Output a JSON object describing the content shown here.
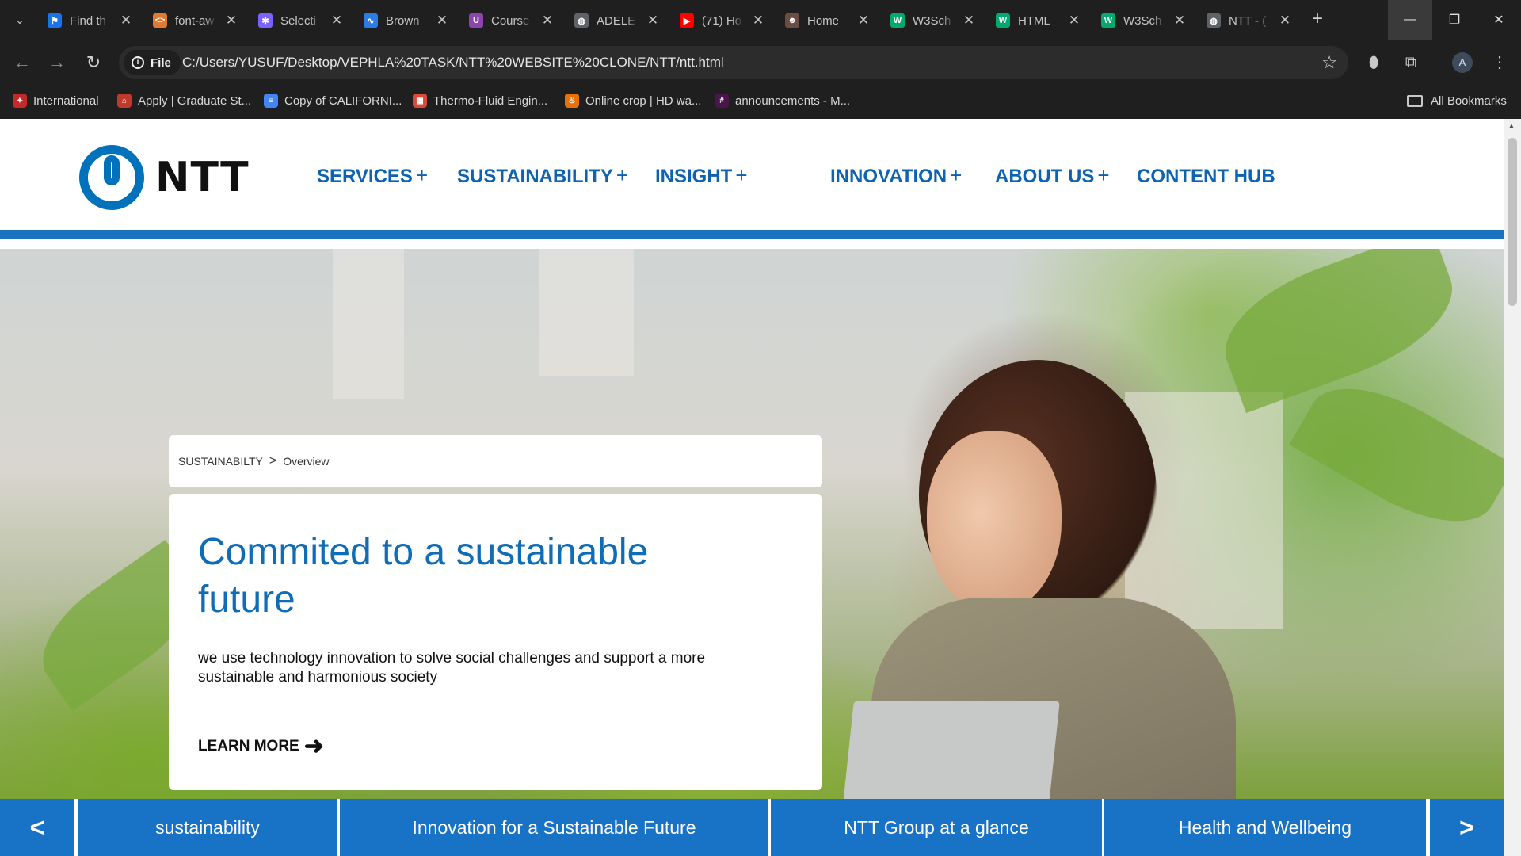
{
  "browser": {
    "tabs": [
      {
        "title": "Find th",
        "favicon": "flag-icon",
        "favicon_color": "#1a73e8",
        "favicon_glyph": "⚑"
      },
      {
        "title": "font-aw",
        "favicon": "code-icon",
        "favicon_color": "#e07a2f",
        "favicon_glyph": "<>"
      },
      {
        "title": "Selecti",
        "favicon": "figma-icon",
        "favicon_color": "#7b61ff",
        "favicon_glyph": "✱"
      },
      {
        "title": "Brown",
        "favicon": "chart-icon",
        "favicon_color": "#2d7be5",
        "favicon_glyph": "∿"
      },
      {
        "title": "Course",
        "favicon": "course-icon",
        "favicon_color": "#8e44ad",
        "favicon_glyph": "U"
      },
      {
        "title": "ADELE",
        "favicon": "globe-icon",
        "favicon_color": "#5f6368",
        "favicon_glyph": "◍"
      },
      {
        "title": "(71) Ho",
        "favicon": "youtube-icon",
        "favicon_color": "#ff0000",
        "favicon_glyph": "▶"
      },
      {
        "title": "Home",
        "favicon": "person-icon",
        "favicon_color": "#6d4c41",
        "favicon_glyph": "☻"
      },
      {
        "title": "W3Sch",
        "favicon": "w3schools-icon",
        "favicon_color": "#04aa6d",
        "favicon_glyph": "W"
      },
      {
        "title": "HTML",
        "favicon": "w3schools-icon",
        "favicon_color": "#04aa6d",
        "favicon_glyph": "W"
      },
      {
        "title": "W3Sch",
        "favicon": "w3schools-icon",
        "favicon_color": "#04aa6d",
        "favicon_glyph": "W"
      },
      {
        "title": "NTT - (",
        "favicon": "globe-icon",
        "favicon_color": "#5f6368",
        "favicon_glyph": "◍"
      }
    ],
    "file_chip": "File",
    "url": "C:/Users/YUSUF/Desktop/VEPHLA%20TASK/NTT%20WEBSITE%20CLONE/NTT/ntt.html",
    "avatar_letter": "A",
    "bookmarks": [
      {
        "label": "International",
        "icon": "red-bird-icon",
        "color": "#c62828",
        "glyph": "✦"
      },
      {
        "label": "Apply | Graduate St...",
        "icon": "university-icon",
        "color": "#c0392b",
        "glyph": "⌂"
      },
      {
        "label": "Copy of CALIFORNI...",
        "icon": "docs-icon",
        "color": "#4285f4",
        "glyph": "≡"
      },
      {
        "label": "Thermo-Fluid Engin...",
        "icon": "calendar-icon",
        "color": "#d84a3a",
        "glyph": "▦"
      },
      {
        "label": "Online crop | HD wa...",
        "icon": "flame-icon",
        "color": "#e8710a",
        "glyph": "♨"
      },
      {
        "label": "announcements - M...",
        "icon": "slack-icon",
        "color": "#4a154b",
        "glyph": "#"
      }
    ],
    "all_bookmarks": "All Bookmarks"
  },
  "site": {
    "logo_text": "NTT",
    "menu": [
      {
        "label": "SERVICES",
        "plus": "+"
      },
      {
        "label": "SUSTAINABILITY",
        "plus": "+"
      },
      {
        "label": "INSIGHT",
        "plus": "+"
      },
      {
        "label": "INNOVATION",
        "plus": "+"
      },
      {
        "label": "ABOUT US",
        "plus": "+"
      },
      {
        "label": "CONTENT HUB",
        "plus": ""
      }
    ],
    "breadcrumb": {
      "root": "SUSTAINABILTY",
      "separator": ">",
      "current": "Overview"
    },
    "hero": {
      "title": "Commited to a sustainable future",
      "text": "we use technology innovation to solve social challenges and support a more sustainable and harmonious society",
      "cta": "LEARN MORE",
      "cta_arrow": "➜"
    },
    "carousel": {
      "prev": "<",
      "next": ">",
      "items": [
        "sustainability",
        "Innovation for a Sustainable Future",
        "NTT Group at a glance",
        "Health and Wellbeing"
      ]
    },
    "colors": {
      "brand_blue": "#0f6cb6",
      "nav_blue": "#0d62b1",
      "band_blue": "#1872c5"
    }
  }
}
